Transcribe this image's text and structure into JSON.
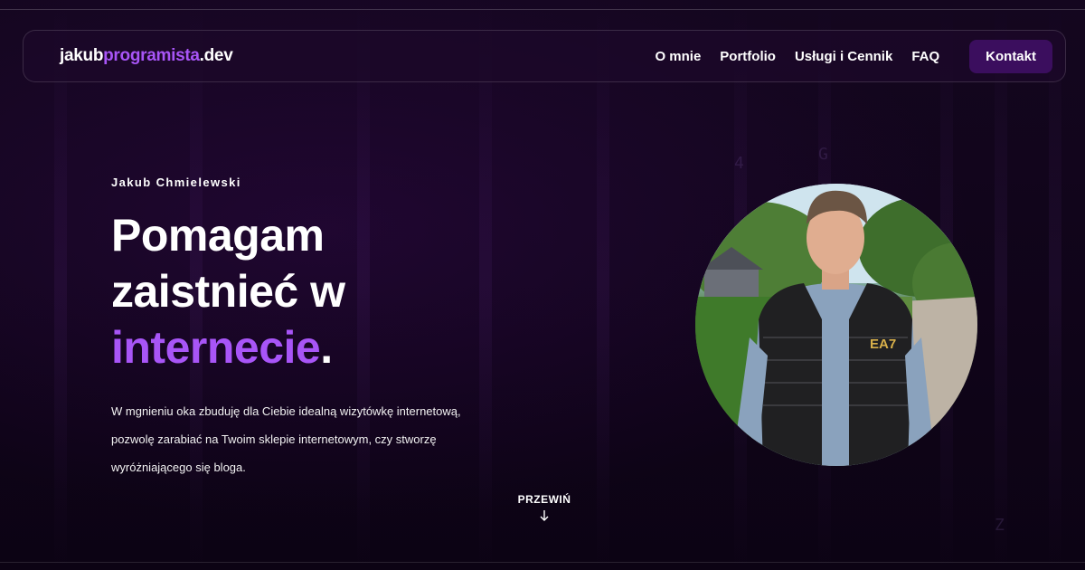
{
  "header": {
    "logo": {
      "part1": "jakub",
      "part2": "programista",
      "part3": ".dev"
    },
    "nav": [
      {
        "label": "O mnie"
      },
      {
        "label": "Portfolio"
      },
      {
        "label": "Usługi i Cennik"
      },
      {
        "label": "FAQ"
      }
    ],
    "contact_label": "Kontakt"
  },
  "hero": {
    "eyebrow": "Jakub Chmielewski",
    "headline_line1": "Pomagam",
    "headline_line2": "zaistnieć w",
    "headline_accent": "internecie",
    "headline_end": ".",
    "description": "W mgnieniu oka zbuduję dla Ciebie idealną wizytówkę internetową, pozwolę zarabiać na Twoim sklepie internetowym, czy stworzę wyróżniającego się bloga.",
    "portrait_vest_logo": "EA7"
  },
  "scroll": {
    "label": "PRZEWIŃ",
    "icon": "arrow-down-icon"
  },
  "colors": {
    "accent": "#a855f7",
    "background": "#0d0416",
    "button": "#3b0e5e"
  }
}
